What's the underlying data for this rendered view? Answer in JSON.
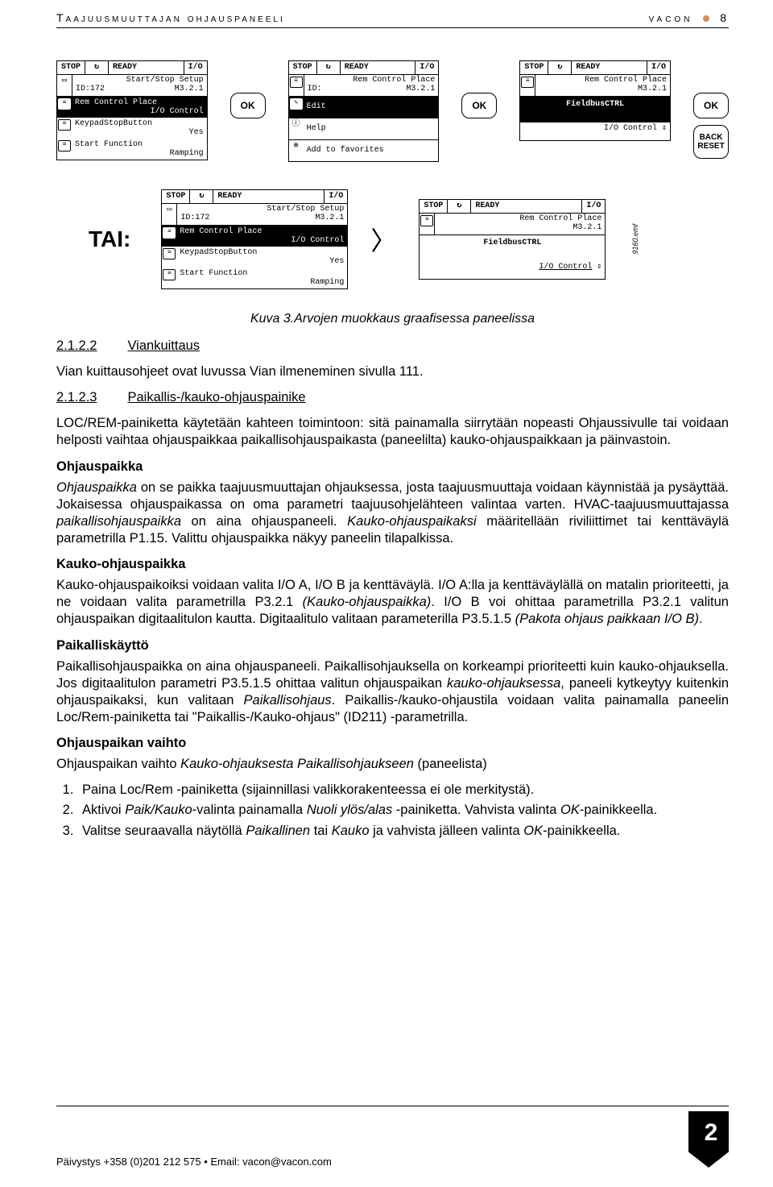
{
  "header": {
    "left": "Taajuusmuuttajan ohjauspaneeli",
    "brand": "vacon",
    "pagenum": "8"
  },
  "panels": {
    "statusStop": "STOP",
    "statusReady": "READY",
    "statusIO": "I/O",
    "p1": {
      "title": "Start/Stop Setup",
      "loc": "ID:172",
      "code": "M3.2.1",
      "i1a": "Rem Control Place",
      "i1b": "I/O Control",
      "i2a": "KeypadStopButton",
      "i2b": "Yes",
      "i3a": "Start Function",
      "i3b": "Ramping"
    },
    "p2": {
      "title": "Rem Control Place",
      "loc": "ID:",
      "code": "M3.2.1",
      "i1": "Edit",
      "i2": "Help",
      "i3": "Add to favorites"
    },
    "p3": {
      "title": "Rem Control Place",
      "code": "M3.2.1",
      "mid": "FieldbusCTRL",
      "bot": "I/O Control"
    },
    "btnOK": "OK",
    "btnBack": "BACK",
    "btnReset": "RESET",
    "tai": "TAI:",
    "emf": "9160.emf"
  },
  "caption": "Kuva 3.Arvojen muokkaus graafisessa paneelissa",
  "sections": {
    "s1num": "2.1.2.2",
    "s1title": "Viankuittaus",
    "s1body": "Vian kuittausohjeet ovat luvussa Vian ilmeneminen sivulla 111.",
    "s2num": "2.1.2.3",
    "s2title": "Paikallis-/kauko-ohjauspainike",
    "s2body": "LOC/REM-painiketta käytetään kahteen toimintoon: sitä painamalla siirrytään nopeasti Ohjaussivulle tai voidaan helposti vaihtaa ohjauspaikkaa paikallisohjauspaikasta (paneelilta) kauko-ohjauspaikkaan ja päinvastoin.",
    "h1": "Ohjauspaikka",
    "p1a": "Ohjauspaikka",
    "p1b": " on se paikka taajuusmuuttajan ohjauksessa, josta taajuusmuuttaja voidaan käynnistää ja pysäyttää. Jokaisessa ohjauspaikassa on oma parametri taajuusohjelähteen valintaa varten. HVAC-taajuusmuuttajassa ",
    "p1c": "paikallisohjauspaikka",
    "p1d": " on aina ohjauspaneeli. ",
    "p1e": "Kauko-ohjauspaikaksi",
    "p1f": " määritellään riviliittimet tai kenttäväylä parametrilla P1.15. Valittu ohjauspaikka näkyy paneelin tilapalkissa.",
    "h2": "Kauko-ohjauspaikka",
    "p2a": "Kauko-ohjauspaikoiksi voidaan valita I/O A, I/O B ja kenttäväylä. I/O A:lla ja kenttäväylällä on matalin prioriteetti, ja ne voidaan valita parametrilla P3.2.1 ",
    "p2b": "(Kauko-ohjauspaikka)",
    "p2c": ". I/O B voi ohittaa parametrilla P3.2.1 valitun ohjauspaikan digitaalitulon kautta. Digitaalitulo valitaan parameterilla P3.5.1.5 ",
    "p2d": "(Pakota ohjaus paikkaan I/O B)",
    "p2e": ".",
    "h3": "Paikalliskäyttö",
    "p3a": "Paikallisohjauspaikka on aina ohjauspaneeli. Paikallisohjauksella on korkeampi prioriteetti kuin kauko-ohjauksella. Jos digitaalitulon parametri P3.5.1.5 ohittaa valitun ohjauspaikan ",
    "p3b": "kauko-ohjauksessa",
    "p3c": ", paneeli kytkeytyy kuitenkin ohjauspaikaksi, kun valitaan ",
    "p3d": "Paikallisohjaus",
    "p3e": ". Paikallis-/kauko-ohjaustila voidaan valita painamalla paneelin Loc/Rem-painiketta tai \"Paikallis-/Kauko-ohjaus\" (ID211) -parametrilla.",
    "h4": "Ohjauspaikan vaihto",
    "p4a": "Ohjauspaikan vaihto ",
    "p4b": "Kauko-ohjauksesta Paikallisohjaukseen",
    "p4c": " (paneelista)",
    "li1": "Paina Loc/Rem -painiketta (sijainnillasi valikkorakenteessa ei ole merkitystä).",
    "li2a": "Aktivoi ",
    "li2b": "Paik/Kauko",
    "li2c": "-valinta painamalla ",
    "li2d": "Nuoli ylös/alas",
    "li2e": " -painiketta. Vahvista valinta ",
    "li2f": "OK",
    "li2g": "-painikkeella.",
    "li3a": "Valitse seuraavalla näytöllä ",
    "li3b": "Paikallinen",
    "li3c": " tai ",
    "li3d": "Kauko",
    "li3e": " ja vahvista jälleen valinta ",
    "li3f": "OK",
    "li3g": "-painikkeella."
  },
  "footer": {
    "text": "Päivystys +358 (0)201 212 575 • Email: vacon@vacon.com",
    "chap": "2"
  }
}
